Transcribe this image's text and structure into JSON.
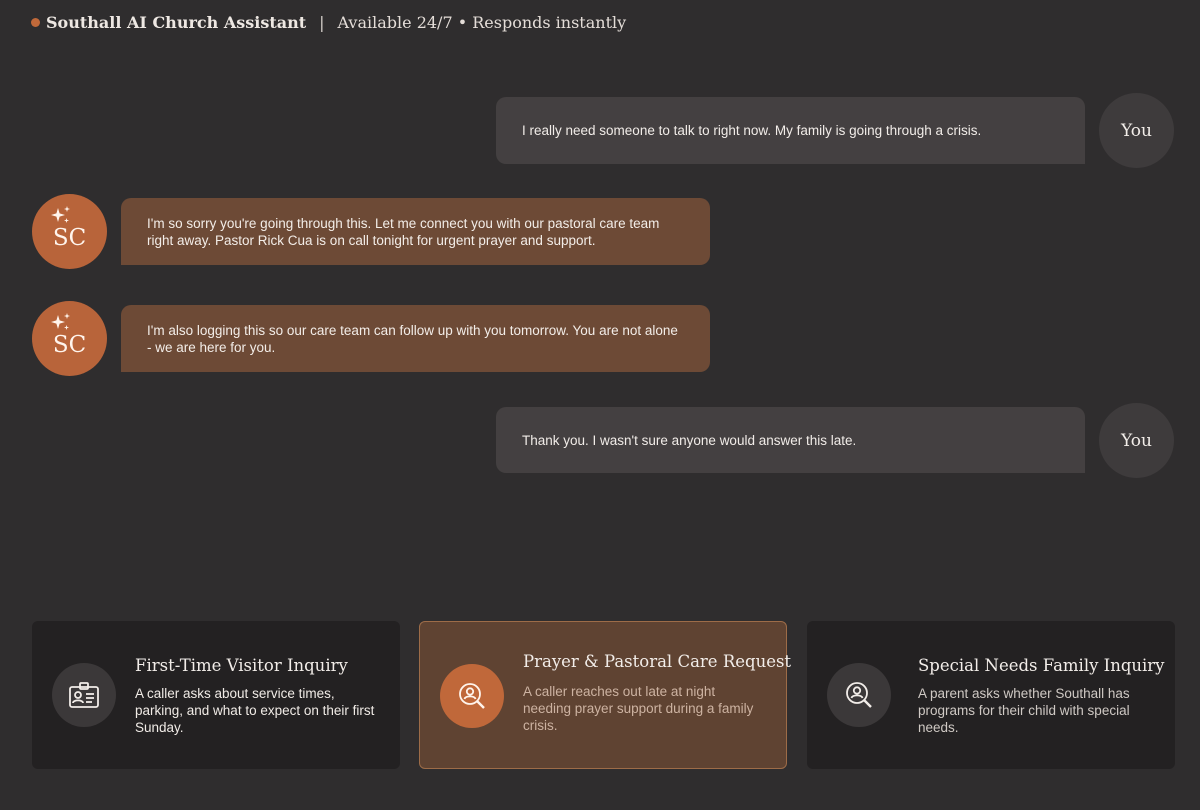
{
  "header": {
    "title": "Southall AI Church Assistant",
    "separator": "|",
    "subtitle": "Available 24/7 • Responds instantly",
    "status_color": "#c0693a"
  },
  "messages": [
    {
      "sender": "user",
      "avatar_label": "You",
      "text": "I really need someone to talk to right now. My family is going through a crisis."
    },
    {
      "sender": "assistant",
      "avatar_label": "SC",
      "text": "I'm so sorry you're going through this. Let me connect you with our pastoral care team right away. Pastor Rick Cua is on call tonight for urgent prayer and support."
    },
    {
      "sender": "assistant",
      "avatar_label": "SC",
      "text": "I'm also logging this so our care team can follow up with you tomorrow. You are not alone - we are here for you."
    },
    {
      "sender": "user",
      "avatar_label": "You",
      "text": "Thank you. I wasn't sure anyone would answer this late."
    }
  ],
  "scenarios": [
    {
      "title": "First-Time Visitor Inquiry",
      "description": "A caller asks about service times, parking, and what to expect on their first Sunday.",
      "icon": "id-card-icon",
      "selected": false
    },
    {
      "title": "Prayer & Pastoral Care Request",
      "description": "A caller reaches out late at night needing prayer support during a family crisis.",
      "icon": "person-search-icon",
      "selected": true
    },
    {
      "title": "Special Needs Family Inquiry",
      "description": "A parent asks whether Southall has programs for their child with special needs.",
      "icon": "person-search-icon",
      "selected": false
    }
  ],
  "colors": {
    "background": "#2f2d2e",
    "accent": "#c0693a",
    "assistant_bubble": "#6d4a36",
    "user_bubble": "#444041"
  }
}
